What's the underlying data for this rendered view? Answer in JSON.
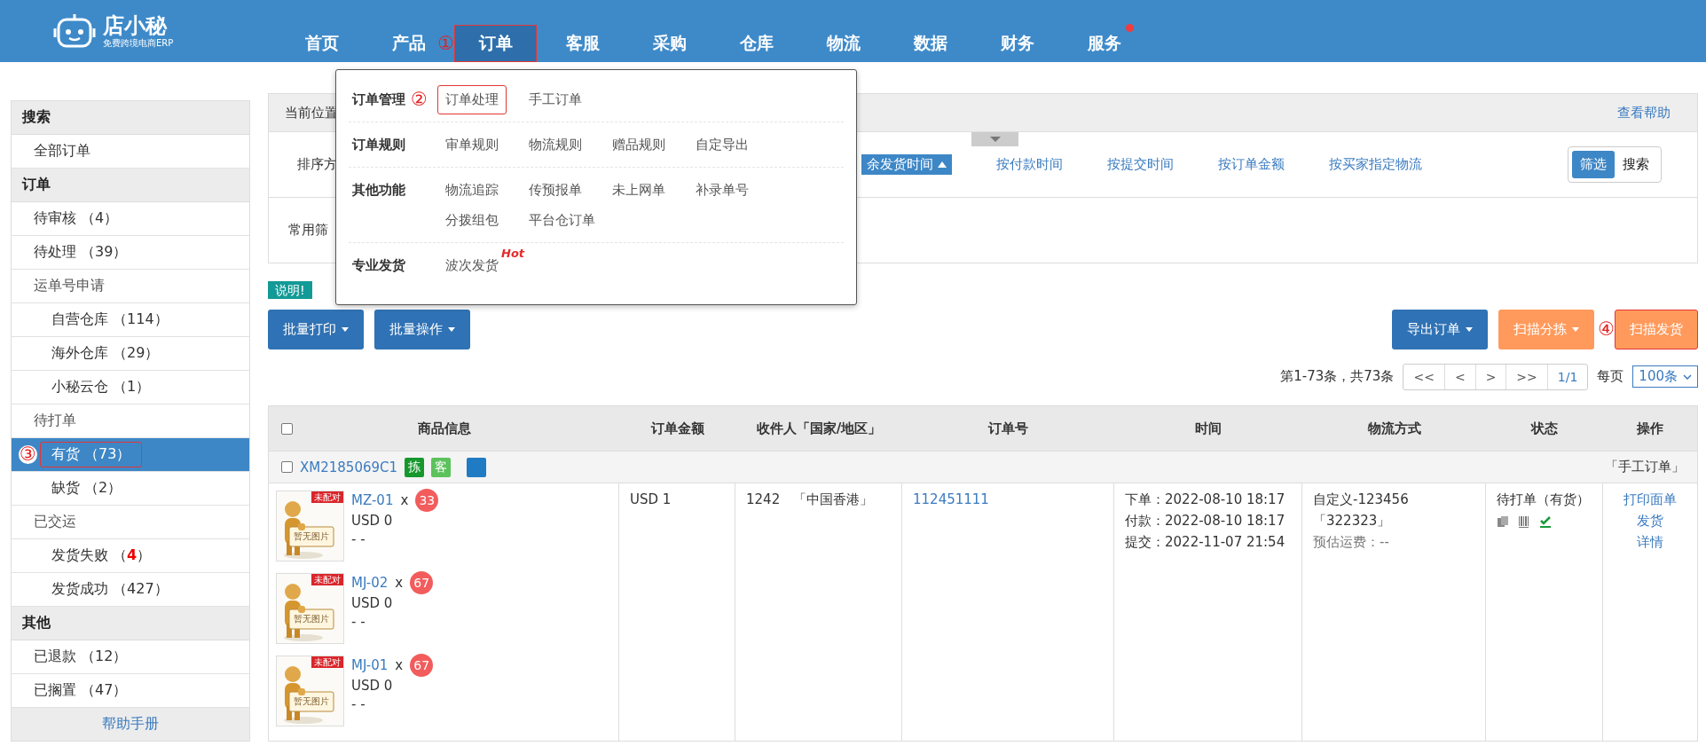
{
  "header": {
    "logo": {
      "name": "店小秘",
      "tagline": "免费跨境电商ERP"
    },
    "nav": [
      {
        "label": "首页",
        "selected": false
      },
      {
        "label": "产品",
        "selected": false,
        "marker": "①"
      },
      {
        "label": "订单",
        "selected": true,
        "outlined": true
      },
      {
        "label": "客服",
        "selected": false
      },
      {
        "label": "采购",
        "selected": false
      },
      {
        "label": "仓库",
        "selected": false
      },
      {
        "label": "物流",
        "selected": false
      },
      {
        "label": "数据",
        "selected": false
      },
      {
        "label": "财务",
        "selected": false
      },
      {
        "label": "服务",
        "selected": false,
        "notice": true
      }
    ]
  },
  "menu": {
    "groups": [
      {
        "title": "订单管理",
        "marker": "②",
        "items": [
          {
            "label": "订单处理",
            "outlined": true
          },
          {
            "label": "手工订单"
          }
        ]
      },
      {
        "title": "订单规则",
        "items": [
          {
            "label": "审单规则"
          },
          {
            "label": "物流规则"
          },
          {
            "label": "赠品规则"
          },
          {
            "label": "自定导出"
          }
        ]
      },
      {
        "title": "其他功能",
        "items": [
          {
            "label": "物流追踪"
          },
          {
            "label": "传预报单"
          },
          {
            "label": "未上网单"
          },
          {
            "label": "补录单号"
          },
          {
            "label": "分拨组包"
          },
          {
            "label": "平台仓订单"
          }
        ]
      },
      {
        "title": "专业发货",
        "items": [
          {
            "label": "波次发货",
            "badge": "Hot"
          }
        ]
      }
    ]
  },
  "sidebar": {
    "sections": [
      {
        "title": "搜索",
        "items": [
          {
            "label": "全部订单",
            "selected": false
          }
        ]
      },
      {
        "title": "订单",
        "items": [
          {
            "label": "待审核 （4）",
            "selected": false
          },
          {
            "label": "待处理 （39）",
            "selected": false
          },
          {
            "label": "运单号申请",
            "selected": false,
            "children": [
              {
                "label": "自营仓库 （114）",
                "selected": false
              },
              {
                "label": "海外仓库 （29）",
                "selected": false
              },
              {
                "label": "小秘云仓 （1）",
                "selected": false
              }
            ]
          },
          {
            "label": "待打单",
            "selected": false,
            "children": [
              {
                "label": "有货 （73）",
                "selected": true,
                "outlined": true,
                "marker": "③"
              },
              {
                "label": "缺货 （2）",
                "selected": false
              }
            ]
          },
          {
            "label": "已交运",
            "selected": false,
            "children": [
              {
                "label": "发货失败 （**4**）",
                "selected": false
              },
              {
                "label": "发货成功 （427）",
                "selected": false
              }
            ]
          }
        ]
      },
      {
        "title": "其他",
        "items": [
          {
            "label": "已退款 （12）",
            "selected": false
          },
          {
            "label": "已搁置 （47）",
            "selected": false
          }
        ]
      }
    ],
    "footer_link": "帮助手册"
  },
  "breadcrumb": {
    "label": "当前位置",
    "help_link": "查看帮助"
  },
  "sort": {
    "label": "排序方",
    "options": [
      {
        "label": "余发货时间",
        "selected": true
      },
      {
        "label": "按付款时间",
        "selected": false
      },
      {
        "label": "按提交时间",
        "selected": false
      },
      {
        "label": "按订单金额",
        "selected": false
      },
      {
        "label": "按买家指定物流",
        "selected": false
      }
    ]
  },
  "mode_toggle": [
    {
      "label": "筛选",
      "selected": true
    },
    {
      "label": "搜索",
      "selected": false
    }
  ],
  "filter": {
    "label": "常用筛"
  },
  "notice_tag": "说明!",
  "bulk_buttons": [
    "批量打印",
    "批量操作"
  ],
  "action_buttons": [
    {
      "label": "导出订单",
      "kind": "primary",
      "caret": true
    },
    {
      "label": "扫描分拣",
      "kind": "warning",
      "caret": true
    },
    {
      "label": "扫描发货",
      "kind": "warning",
      "caret": false,
      "outlined": true,
      "marker": "④"
    }
  ],
  "pagination": {
    "summary": "第1-73条，共73条",
    "buttons": [
      "<<",
      "<",
      ">",
      ">>",
      "1/1"
    ],
    "per_page_label": "每页",
    "per_page": "100条"
  },
  "table": {
    "select_all_checked": false,
    "columns": [
      "商品信息",
      "订单金额",
      "收件人「国家/地区」",
      "订单号",
      "时间",
      "物流方式",
      "状态",
      "操作"
    ],
    "orders": [
      {
        "order_id": "XM2185069C1",
        "checked": false,
        "tags": [
          {
            "label": "拣",
            "color": "#16982c"
          },
          {
            "label": "客",
            "color": "#5cc25c"
          },
          {
            "color": "#1f7bc3"
          }
        ],
        "source": "「手工订单」",
        "products": [
          {
            "sku": "MZ-01",
            "times_sign": "x",
            "qty": "33",
            "price": "USD 0",
            "note": "- -",
            "image_badge": "未配对",
            "image_caption": "暂无图片"
          },
          {
            "sku": "MJ-02",
            "times_sign": "x",
            "qty": "67",
            "price": "USD 0",
            "note": "- -",
            "image_badge": "未配对",
            "image_caption": "暂无图片"
          },
          {
            "sku": "MJ-01",
            "times_sign": "x",
            "qty": "67",
            "price": "USD 0",
            "note": "- -",
            "image_badge": "未配对",
            "image_caption": "暂无图片"
          }
        ],
        "amount": "USD 1",
        "recipient": "1242",
        "country": "「中国香港」",
        "order_no": "112451111",
        "times": [
          "下单：2022-08-10 18:17",
          "付款：2022-08-10 18:17",
          "提交：2022-11-07 21:54"
        ],
        "logistics": {
          "method": "自定义-123456",
          "tracking": "「322323」",
          "freight": "预估运费：--"
        },
        "status": "待打单（有货）",
        "actions": [
          "打印面单",
          "发货",
          "详情"
        ]
      }
    ]
  }
}
